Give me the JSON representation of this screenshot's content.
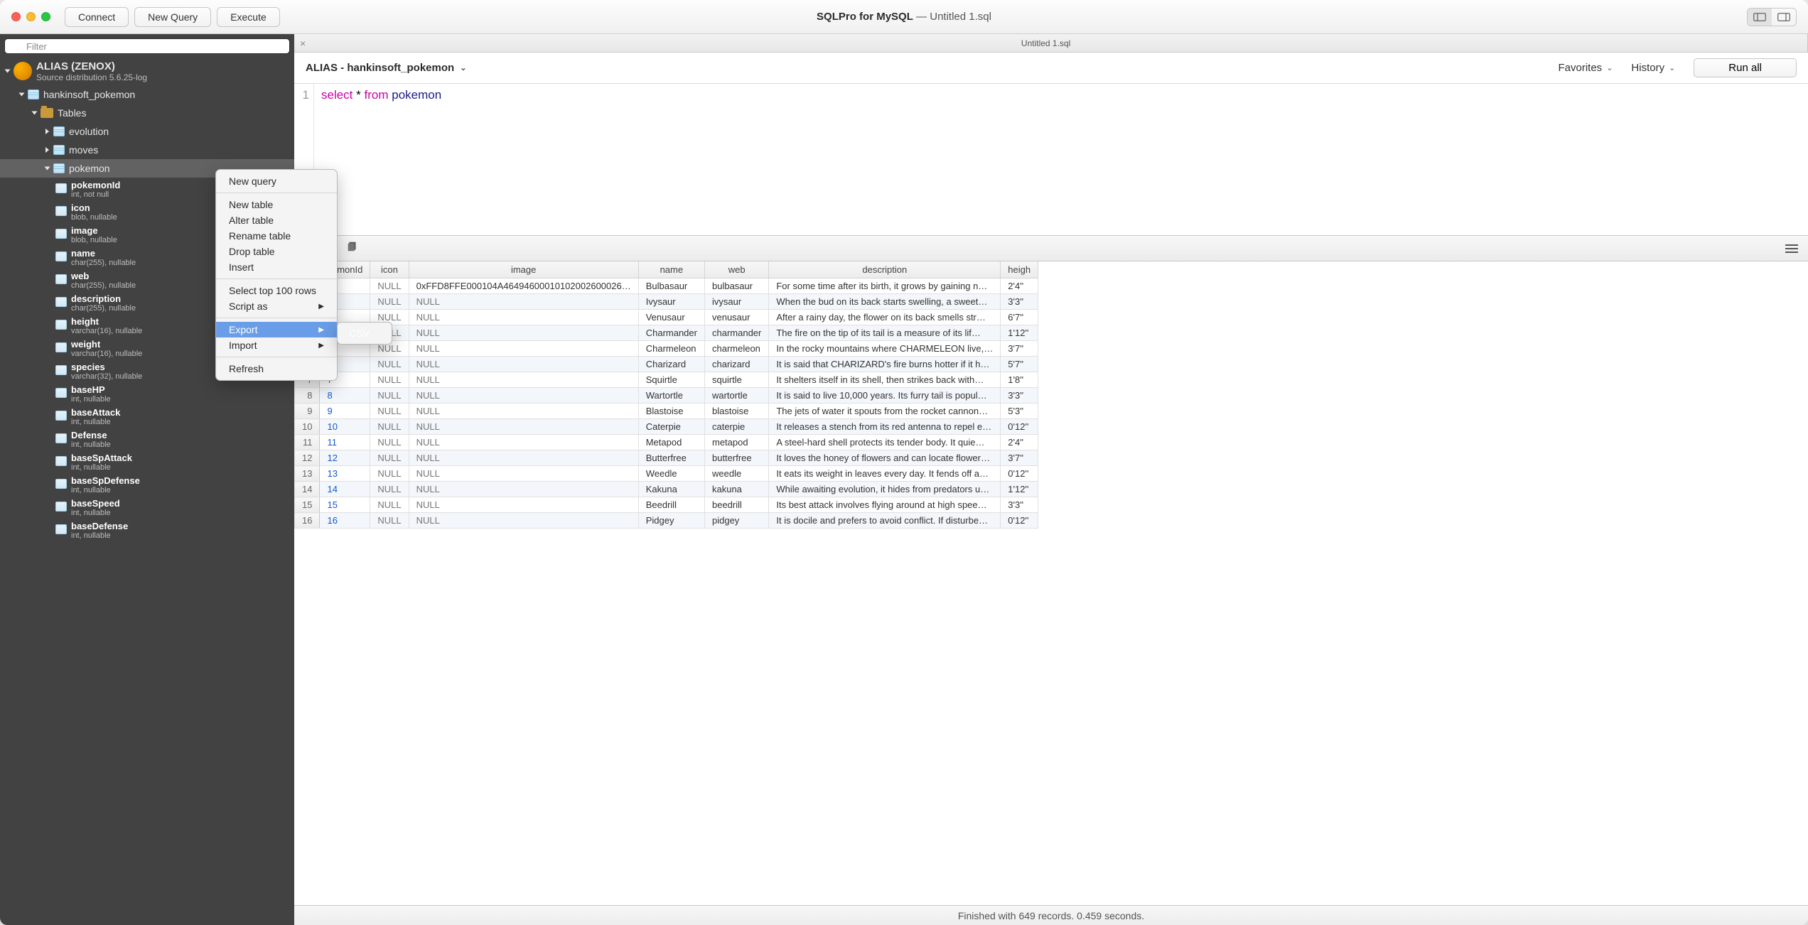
{
  "window": {
    "app_title": "SQLPro for MySQL",
    "doc_title": "Untitled 1.sql"
  },
  "toolbar": {
    "connect": "Connect",
    "new_query": "New Query",
    "execute": "Execute"
  },
  "sidebar": {
    "filter_placeholder": "Filter",
    "connection": {
      "name": "ALIAS (ZENOX)",
      "subtitle": "Source distribution 5.6.25-log"
    },
    "database": "hankinsoft_pokemon",
    "tables_label": "Tables",
    "tables": [
      "evolution",
      "moves",
      "pokemon"
    ],
    "columns": [
      {
        "name": "pokemonId",
        "type": "int, not null"
      },
      {
        "name": "icon",
        "type": "blob, nullable"
      },
      {
        "name": "image",
        "type": "blob, nullable"
      },
      {
        "name": "name",
        "type": "char(255), nullable"
      },
      {
        "name": "web",
        "type": "char(255), nullable"
      },
      {
        "name": "description",
        "type": "char(255), nullable"
      },
      {
        "name": "height",
        "type": "varchar(16), nullable"
      },
      {
        "name": "weight",
        "type": "varchar(16), nullable"
      },
      {
        "name": "species",
        "type": "varchar(32), nullable"
      },
      {
        "name": "baseHP",
        "type": "int, nullable"
      },
      {
        "name": "baseAttack",
        "type": "int, nullable"
      },
      {
        "name": "Defense",
        "type": "int, nullable"
      },
      {
        "name": "baseSpAttack",
        "type": "int, nullable"
      },
      {
        "name": "baseSpDefense",
        "type": "int, nullable"
      },
      {
        "name": "baseSpeed",
        "type": "int, nullable"
      },
      {
        "name": "baseDefense",
        "type": "int, nullable"
      }
    ]
  },
  "context_menu": {
    "new_query": "New query",
    "new_table": "New table",
    "alter_table": "Alter table",
    "rename_table": "Rename table",
    "drop_table": "Drop table",
    "insert": "Insert",
    "select_top": "Select top 100 rows",
    "script_as": "Script as",
    "export": "Export",
    "import": "Import",
    "refresh": "Refresh",
    "csv": "CSV"
  },
  "tabs": {
    "tab1": "Untitled 1.sql"
  },
  "context_bar": {
    "db_label": "ALIAS - hankinsoft_pokemon",
    "favorites": "Favorites",
    "history": "History",
    "run_all": "Run all"
  },
  "editor": {
    "line_no": "1",
    "kw_select": "select",
    "star": "*",
    "kw_from": "from",
    "table": "pokemon"
  },
  "grid": {
    "headers": [
      "",
      "kemonId",
      "icon",
      "image",
      "name",
      "web",
      "description",
      "heigh"
    ],
    "rows": [
      {
        "n": "",
        "id": "",
        "icon": "NULL",
        "image": "0xFFD8FFE000104A46494600010102002600026…",
        "name": "Bulbasaur",
        "web": "bulbasaur",
        "desc": "For some time after its birth, it grows by gaining n…",
        "h": "2'4''"
      },
      {
        "n": "",
        "id": "",
        "icon": "NULL",
        "image": "NULL",
        "name": "Ivysaur",
        "web": "ivysaur",
        "desc": "When the bud on its back starts swelling, a sweet…",
        "h": "3'3''"
      },
      {
        "n": "",
        "id": "",
        "icon": "NULL",
        "image": "NULL",
        "name": "Venusaur",
        "web": "venusaur",
        "desc": "After a rainy day, the flower on its back smells str…",
        "h": "6'7''"
      },
      {
        "n": "",
        "id": "",
        "icon": "NULL",
        "image": "NULL",
        "name": "Charmander",
        "web": "charmander",
        "desc": "The fire on the tip of its tail is a measure of its lif…",
        "h": "1'12''"
      },
      {
        "n": "",
        "id": "",
        "icon": "NULL",
        "image": "NULL",
        "name": "Charmeleon",
        "web": "charmeleon",
        "desc": "In the rocky mountains where CHARMELEON live,…",
        "h": "3'7''"
      },
      {
        "n": "",
        "id": "",
        "icon": "NULL",
        "image": "NULL",
        "name": "Charizard",
        "web": "charizard",
        "desc": "It is said that CHARIZARD's fire burns hotter if it h…",
        "h": "5'7''"
      },
      {
        "n": "7",
        "id": "7",
        "icon": "NULL",
        "image": "NULL",
        "name": "Squirtle",
        "web": "squirtle",
        "desc": "It shelters itself in its shell, then strikes back with…",
        "h": "1'8''"
      },
      {
        "n": "8",
        "id": "8",
        "icon": "NULL",
        "image": "NULL",
        "name": "Wartortle",
        "web": "wartortle",
        "desc": "It is said to live 10,000 years. Its furry tail is popul…",
        "h": "3'3''"
      },
      {
        "n": "9",
        "id": "9",
        "icon": "NULL",
        "image": "NULL",
        "name": "Blastoise",
        "web": "blastoise",
        "desc": "The jets of water it spouts from the rocket cannon…",
        "h": "5'3''"
      },
      {
        "n": "10",
        "id": "10",
        "icon": "NULL",
        "image": "NULL",
        "name": "Caterpie",
        "web": "caterpie",
        "desc": "It releases a stench from its red antenna to repel e…",
        "h": "0'12''"
      },
      {
        "n": "11",
        "id": "11",
        "icon": "NULL",
        "image": "NULL",
        "name": "Metapod",
        "web": "metapod",
        "desc": "A steel-hard shell protects its tender body. It quie…",
        "h": "2'4''"
      },
      {
        "n": "12",
        "id": "12",
        "icon": "NULL",
        "image": "NULL",
        "name": "Butterfree",
        "web": "butterfree",
        "desc": "It loves the honey of flowers and can locate flower…",
        "h": "3'7''"
      },
      {
        "n": "13",
        "id": "13",
        "icon": "NULL",
        "image": "NULL",
        "name": "Weedle",
        "web": "weedle",
        "desc": "It eats its weight in leaves every day. It fends off a…",
        "h": "0'12''"
      },
      {
        "n": "14",
        "id": "14",
        "icon": "NULL",
        "image": "NULL",
        "name": "Kakuna",
        "web": "kakuna",
        "desc": "While awaiting evolution, it hides from predators u…",
        "h": "1'12''"
      },
      {
        "n": "15",
        "id": "15",
        "icon": "NULL",
        "image": "NULL",
        "name": "Beedrill",
        "web": "beedrill",
        "desc": "Its best attack involves flying around at high spee…",
        "h": "3'3''"
      },
      {
        "n": "16",
        "id": "16",
        "icon": "NULL",
        "image": "NULL",
        "name": "Pidgey",
        "web": "pidgey",
        "desc": "It is docile and prefers to avoid conflict. If disturbe…",
        "h": "0'12''"
      }
    ]
  },
  "status": "Finished with 649 records. 0.459 seconds."
}
